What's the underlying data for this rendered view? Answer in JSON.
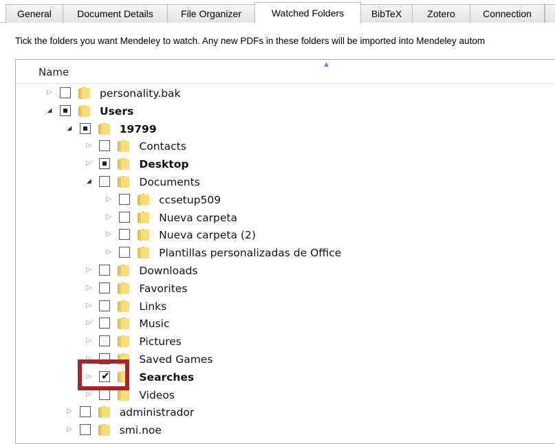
{
  "tabs": [
    {
      "label": "General",
      "active": false
    },
    {
      "label": "Document Details",
      "active": false
    },
    {
      "label": "File Organizer",
      "active": false
    },
    {
      "label": "Watched Folders",
      "active": true
    },
    {
      "label": "BibTeX",
      "active": false
    },
    {
      "label": "Zotero",
      "active": false
    },
    {
      "label": "Connection",
      "active": false
    }
  ],
  "instruction": "Tick the folders you want Mendeley to watch. Any new PDFs in these folders will be imported into Mendeley autom",
  "tree": {
    "column_header": "Name",
    "rows": [
      {
        "label": "personality.bak",
        "level": 0,
        "expander": "collapsed",
        "check": "unchecked",
        "bold": false
      },
      {
        "label": "Users",
        "level": 0,
        "expander": "expanded",
        "check": "partial",
        "bold": true
      },
      {
        "label": "19799",
        "level": 1,
        "expander": "expanded",
        "check": "partial",
        "bold": true
      },
      {
        "label": "Contacts",
        "level": 2,
        "expander": "collapsed",
        "check": "unchecked",
        "bold": false
      },
      {
        "label": "Desktop",
        "level": 2,
        "expander": "collapsed",
        "check": "partial",
        "bold": true
      },
      {
        "label": "Documents",
        "level": 2,
        "expander": "expanded",
        "check": "unchecked",
        "bold": false
      },
      {
        "label": "ccsetup509",
        "level": 3,
        "expander": "collapsed",
        "check": "unchecked",
        "bold": false
      },
      {
        "label": "Nueva carpeta",
        "level": 3,
        "expander": "collapsed",
        "check": "unchecked",
        "bold": false
      },
      {
        "label": "Nueva carpeta (2)",
        "level": 3,
        "expander": "collapsed",
        "check": "unchecked",
        "bold": false
      },
      {
        "label": "Plantillas personalizadas de Office",
        "level": 3,
        "expander": "collapsed",
        "check": "unchecked",
        "bold": false
      },
      {
        "label": "Downloads",
        "level": 2,
        "expander": "collapsed",
        "check": "unchecked",
        "bold": false
      },
      {
        "label": "Favorites",
        "level": 2,
        "expander": "collapsed",
        "check": "unchecked",
        "bold": false
      },
      {
        "label": "Links",
        "level": 2,
        "expander": "collapsed",
        "check": "unchecked",
        "bold": false
      },
      {
        "label": "Music",
        "level": 2,
        "expander": "collapsed",
        "check": "unchecked",
        "bold": false
      },
      {
        "label": "Pictures",
        "level": 2,
        "expander": "collapsed",
        "check": "unchecked",
        "bold": false
      },
      {
        "label": "Saved Games",
        "level": 2,
        "expander": "collapsed",
        "check": "unchecked",
        "bold": false
      },
      {
        "label": "Searches",
        "level": 2,
        "expander": "collapsed",
        "check": "checked",
        "bold": true
      },
      {
        "label": "Videos",
        "level": 2,
        "expander": "collapsed",
        "check": "unchecked",
        "bold": false
      },
      {
        "label": "administrador",
        "level": 1,
        "expander": "collapsed",
        "check": "unchecked",
        "bold": false
      },
      {
        "label": "smi.noe",
        "level": 1,
        "expander": "collapsed",
        "check": "unchecked",
        "bold": false
      }
    ]
  },
  "colors": {
    "highlight": "#a4242f",
    "folder_light": "#f8dd7e",
    "folder_dark": "#e2b845"
  }
}
